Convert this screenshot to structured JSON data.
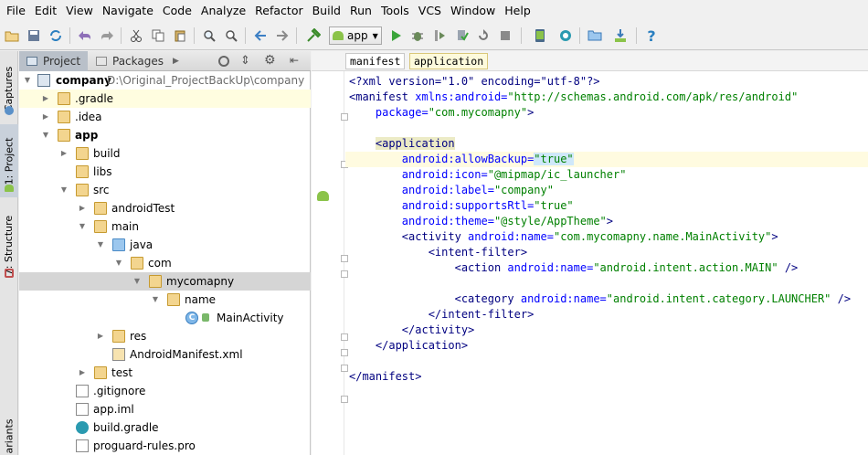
{
  "menu": [
    "File",
    "Edit",
    "View",
    "Navigate",
    "Code",
    "Analyze",
    "Refactor",
    "Build",
    "Run",
    "Tools",
    "VCS",
    "Window",
    "Help"
  ],
  "toolbar": {
    "run_config": "app"
  },
  "left_strip": {
    "captures": "Captures",
    "project": "1: Project",
    "structure": "7: Structure",
    "variants": "ariants"
  },
  "panel": {
    "tab_project": "Project",
    "tab_packages": "Packages"
  },
  "tree": [
    {
      "label": "company",
      "path": "D:\\Original_ProjectBackUp\\company"
    },
    {
      "label": ".gradle"
    },
    {
      "label": ".idea"
    },
    {
      "label": "app"
    },
    {
      "label": "build"
    },
    {
      "label": "libs"
    },
    {
      "label": "src"
    },
    {
      "label": "androidTest"
    },
    {
      "label": "main"
    },
    {
      "label": "java"
    },
    {
      "label": "com"
    },
    {
      "label": "mycomapny"
    },
    {
      "label": "name"
    },
    {
      "label": "MainActivity"
    },
    {
      "label": "res"
    },
    {
      "label": "AndroidManifest.xml"
    },
    {
      "label": "test"
    },
    {
      "label": ".gitignore"
    },
    {
      "label": "app.iml"
    },
    {
      "label": "build.gradle"
    },
    {
      "label": "proguard-rules.pro"
    }
  ],
  "breadcrumbs": [
    "manifest",
    "application"
  ],
  "code": {
    "l1": "<?xml version=\"1.0\" encoding=\"utf-8\"?>",
    "l2a": "<manifest ",
    "l2b": "xmlns:android=",
    "l2c": "\"http://schemas.android.com/apk/res/android\"",
    "l3a": "package=",
    "l3b": "\"com.mycomapny\"",
    "l3c": ">",
    "l5": "<application",
    "l6a": "android:allowBackup=",
    "l6b": "\"true\"",
    "l7a": "android:icon=",
    "l7b": "\"@mipmap/ic_launcher\"",
    "l8a": "android:label=",
    "l8b": "\"company\"",
    "l9a": "android:supportsRtl=",
    "l9b": "\"true\"",
    "l10a": "android:theme=",
    "l10b": "\"@style/AppTheme\"",
    "l10c": ">",
    "l11a": "<activity ",
    "l11b": "android:name=",
    "l11c": "\"com.mycomapny.name.MainActivity\"",
    "l11d": ">",
    "l12": "<intent-filter>",
    "l13a": "<action ",
    "l13b": "android:name=",
    "l13c": "\"android.intent.action.MAIN\"",
    "l13d": " />",
    "l15a": "<category ",
    "l15b": "android:name=",
    "l15c": "\"android.intent.category.LAUNCHER\"",
    "l15d": " />",
    "l16": "</intent-filter>",
    "l17": "</activity>",
    "l18": "</application>",
    "l20": "</manifest>"
  }
}
